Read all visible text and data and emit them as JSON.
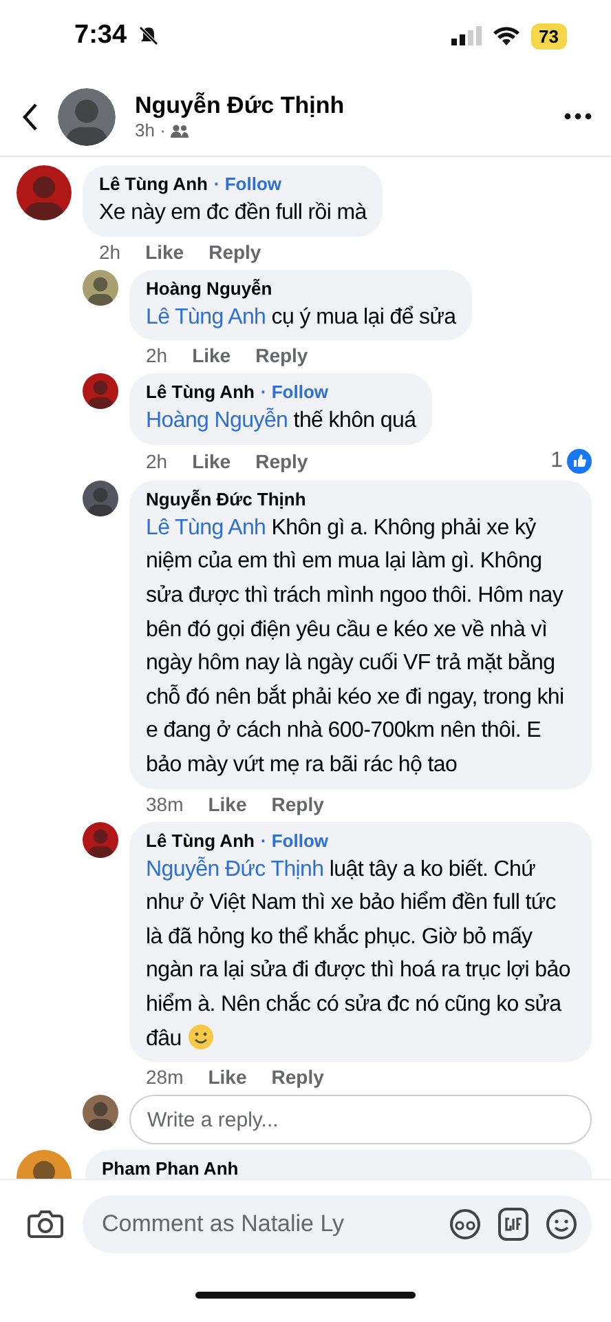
{
  "status_bar": {
    "time": "7:34",
    "battery": "73",
    "muted": true
  },
  "header": {
    "title": "Nguyễn Đức Thịnh",
    "meta": "3h ·"
  },
  "comments": [
    {
      "kind": "comment",
      "author": "Lê Tùng Anh",
      "follow": "· Follow",
      "text": "Xe này em đc đền full rồi mà",
      "time": "2h",
      "actions": [
        "Like",
        "Reply"
      ],
      "color": "#b01818"
    },
    {
      "kind": "reply",
      "author": "Hoàng Nguyễn",
      "mention": "Lê Tùng Anh",
      "text": " cụ ý mua lại để sửa",
      "time": "2h",
      "actions": [
        "Like",
        "Reply"
      ],
      "color": "#a8a070"
    },
    {
      "kind": "reply",
      "author": "Lê Tùng Anh",
      "follow": "· Follow",
      "mention": "Hoàng Nguyễn",
      "text": " thế khôn quá",
      "time": "2h",
      "actions": [
        "Like",
        "Reply"
      ],
      "reactions": "1",
      "color": "#b01818"
    },
    {
      "kind": "reply",
      "author": "Nguyễn Đức Thịnh",
      "mention": "Lê Tùng Anh",
      "text": " Khôn gì a. Không phải xe kỷ niệm của em thì em mua lại làm gì. Không sửa được thì trách mình ngoo thôi. Hôm nay bên đó gọi điện yêu cầu e kéo xe về nhà vì ngày hôm nay là ngày cuối VF trả mặt bằng chỗ đó nên bắt phải kéo xe đi ngay, trong khi e đang ở cách nhà 600-700km nên thôi. E bảo mày vứt mẹ ra bãi rác hộ tao",
      "time": "38m",
      "actions": [
        "Like",
        "Reply"
      ],
      "color": "#555560"
    },
    {
      "kind": "reply",
      "author": "Lê Tùng Anh",
      "follow": "· Follow",
      "mention": "Nguyễn Đức Thịnh",
      "text": " luật tây a ko biết. Chứ như ở Việt Nam thì xe bảo hiểm đền full tức là đã hỏng ko thể khắc phục. Giờ bỏ mấy ngàn ra lại sửa đi được thì hoá ra trục lợi bảo hiểm à. Nên chắc có sửa đc nó cũng ko sửa đâu",
      "smiley": true,
      "time": "28m",
      "actions": [
        "Like",
        "Reply"
      ],
      "color": "#b01818"
    }
  ],
  "reply_box": {
    "placeholder": "Write a reply..."
  },
  "next_comment": {
    "author": "Pham Phan Anh",
    "color": "#e0902a"
  },
  "composer": {
    "placeholder": "Comment as Natalie Ly"
  }
}
